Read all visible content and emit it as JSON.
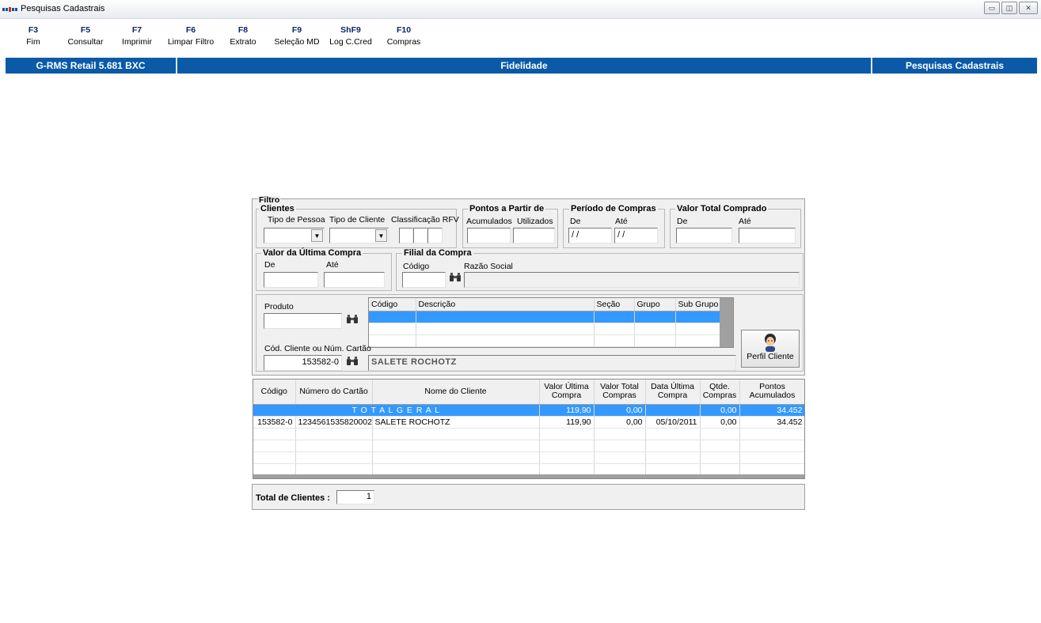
{
  "window": {
    "title": "Pesquisas Cadastrais"
  },
  "fkeys": [
    {
      "key": "F3",
      "label": "Fim"
    },
    {
      "key": "F5",
      "label": "Consultar"
    },
    {
      "key": "F7",
      "label": "Imprimir"
    },
    {
      "key": "F6",
      "label": "Limpar Filtro"
    },
    {
      "key": "F8",
      "label": "Extrato"
    },
    {
      "key": "F9",
      "label": "Seleção MD"
    },
    {
      "key": "ShF9",
      "label": "Log C.Cred"
    },
    {
      "key": "F10",
      "label": "Compras"
    }
  ],
  "status": {
    "app": "G-RMS Retail 5.681 BXC",
    "module": "Fidelidade",
    "screen": "Pesquisas Cadastrais"
  },
  "filtro": {
    "title": "Filtro",
    "clientes": {
      "title": "Clientes",
      "tipo_pessoa": "Tipo de Pessoa",
      "tipo_cliente": "Tipo de Cliente",
      "classificacao": "Classificação RFV"
    },
    "pontos": {
      "title": "Pontos a Partir de",
      "acumulados": "Acumulados",
      "utilizados": "Utilizados"
    },
    "periodo": {
      "title": "Período de Compras",
      "de": "De",
      "ate": "Até",
      "de_value": "/ /",
      "ate_value": "/ /"
    },
    "valor_total": {
      "title": "Valor Total Comprado",
      "de": "De",
      "ate": "Até"
    },
    "ultima_compra": {
      "title": "Valor da Última Compra",
      "de": "De",
      "ate": "Até"
    },
    "filial": {
      "title": "Filial da Compra",
      "codigo": "Código",
      "razao": "Razão Social"
    },
    "produto": {
      "label": "Produto"
    },
    "cliente": {
      "label": "Cód. Cliente ou Núm. Cartão",
      "value": "153582-0",
      "name": "SALETE ROCHOTZ"
    }
  },
  "produto_grid": {
    "headers": [
      "Código",
      "Descrição",
      "Seção",
      "Grupo",
      "Sub Grupo"
    ]
  },
  "perfil_button": {
    "label": "Perfil Cliente"
  },
  "results": {
    "headers": [
      "Código",
      "Número do Cartão",
      "Nome do Cliente",
      "Valor Última Compra",
      "Valor Total Compras",
      "Data Última Compra",
      "Qtde. Compras",
      "Pontos Acumulados"
    ],
    "total_row": {
      "label": "T O T A L  G E R A L",
      "valor_ultima": "119,90",
      "valor_total": "0,00",
      "qtde": "0,00",
      "pontos": "34.452"
    },
    "rows": [
      {
        "codigo": "153582-0",
        "cartao": "1234561535820002",
        "nome": "SALETE ROCHOTZ",
        "valor_ultima": "119,90",
        "valor_total": "0,00",
        "data": "05/10/2011",
        "qtde": "0,00",
        "pontos": "34.452"
      }
    ]
  },
  "footer": {
    "total_label": "Total de Clientes :",
    "total_value": "1"
  }
}
